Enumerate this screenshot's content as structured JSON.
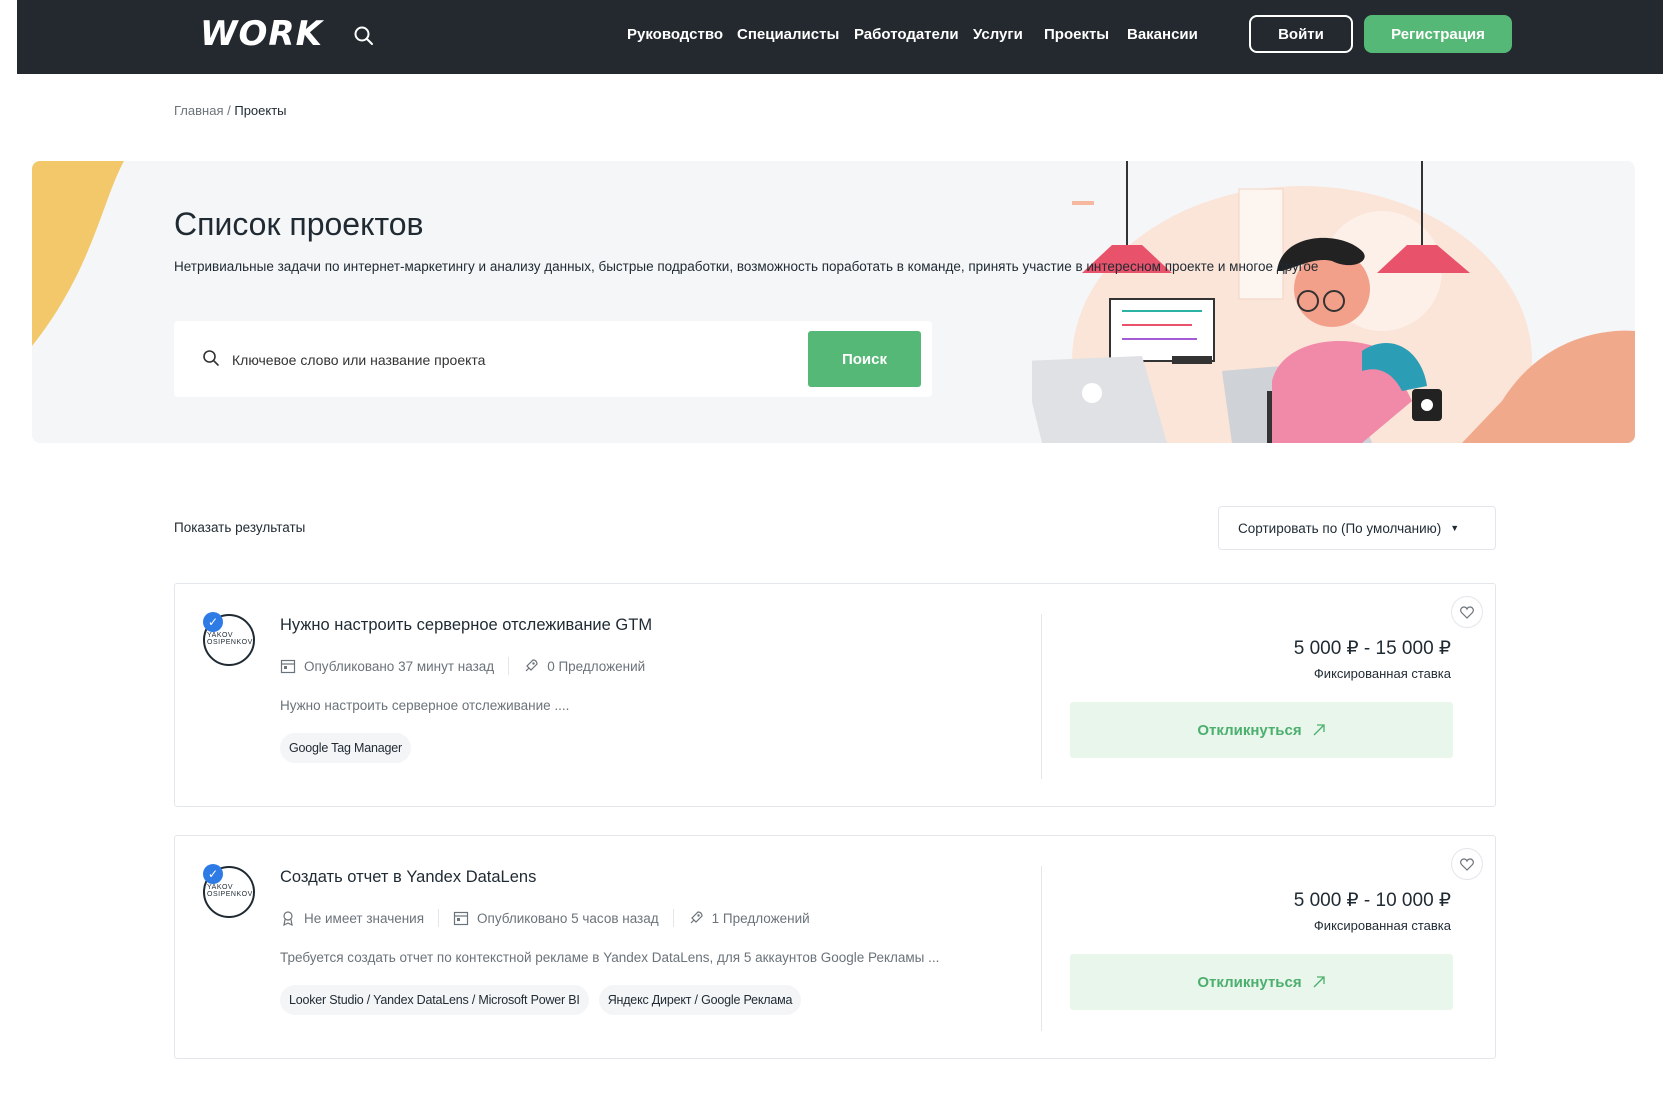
{
  "header": {
    "logo": "WORK",
    "nav": [
      "Руководство",
      "Специалисты",
      "Работодатели",
      "Услуги",
      "Проекты",
      "Вакансии"
    ],
    "login": "Войти",
    "register": "Регистрация"
  },
  "breadcrumb": {
    "home": "Главная",
    "separator": "/",
    "current": "Проекты"
  },
  "hero": {
    "title": "Список проектов",
    "subtitle": "Нетривиальные задачи по интернет-маркетингу и анализу данных, быстрые подработки, возможность поработать в команде, принять участие в интересном проекте и многое другое",
    "search_placeholder": "Ключевое слово или название проекта",
    "search_button": "Поиск"
  },
  "results": {
    "label": "Показать результаты",
    "sort_label": "Сортировать по (По умолчанию)"
  },
  "projects": [
    {
      "avatar_text": "YAKOV OSIPENKOV",
      "title": "Нужно настроить серверное отслеживание GTM",
      "meta": {
        "published": "Опубликовано 37 минут назад",
        "proposals": "0 Предложений"
      },
      "description": "Нужно настроить серверное отслеживание ....",
      "tags": [
        "Google Tag Manager"
      ],
      "price": "5 000 ₽ - 15 000 ₽",
      "rate_type": "Фиксированная ставка",
      "apply": "Откликнуться"
    },
    {
      "avatar_text": "YAKOV OSIPENKOV",
      "title": "Создать отчет в Yandex DataLens",
      "meta": {
        "level": "Не имеет значения",
        "published": "Опубликовано 5 часов назад",
        "proposals": "1 Предложений"
      },
      "description": "Требуется создать отчет по контекстной рекламе в Yandex DataLens, для 5 аккаунтов Google Рекламы ...",
      "tags": [
        "Looker Studio / Yandex DataLens / Microsoft Power BI",
        "Яндекс Директ / Google Реклама"
      ],
      "price": "5 000 ₽ - 10 000 ₽",
      "rate_type": "Фиксированная ставка",
      "apply": "Откликнуться"
    }
  ],
  "colors": {
    "header_bg": "#23292f",
    "accent_green": "#56b877",
    "apply_bg": "#e8f6ec",
    "verified_blue": "#2f7be5",
    "hero_bg": "#f5f6f8"
  }
}
